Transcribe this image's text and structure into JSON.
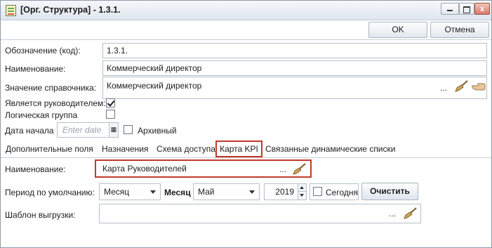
{
  "window": {
    "title": "[Орг. Структура] - 1.3.1.",
    "close_glyph": "x"
  },
  "toolbar": {
    "ok_label": "OK",
    "cancel_label": "Отмена"
  },
  "form": {
    "code_label": "Обозначение (код):",
    "code_value": "1.3.1.",
    "name_label": "Наименование:",
    "name_value": "Коммерческий директор",
    "ref_label": "Значение справочника:",
    "ref_value": "Коммерческий директор",
    "ref_dots": "...",
    "is_head_label": "Является руководителем:",
    "is_head_checked": true,
    "logical_group_label": "Логическая группа",
    "logical_group_checked": false,
    "start_date_label": "Дата начала",
    "start_date_placeholder": "Enter date",
    "date_btn_glyph": "▦",
    "archived_label": "Архивный",
    "archived_checked": false
  },
  "tabs": [
    {
      "label": "Дополнительные поля"
    },
    {
      "label": "Назначения"
    },
    {
      "label": "Схема доступа"
    },
    {
      "label": "Карта KPI",
      "active": true
    },
    {
      "label": "Связанные динамические списки"
    }
  ],
  "kpi": {
    "name_label": "Наименование:",
    "name_value": "Карта Руководителей",
    "dots": "...",
    "period_label": "Период по умолчанию:",
    "period_value": "Месяц",
    "month_label": "Месяц",
    "month_value": "Май",
    "year_value": "2019",
    "today_label": "Сегодня",
    "today_checked": false,
    "clear_label": "Очистить",
    "template_label": "Шаблон выгрузки:",
    "template_value": "",
    "template_dots": "..."
  },
  "colors": {
    "highlight": "#c0392b",
    "border": "#b6c0cb"
  }
}
